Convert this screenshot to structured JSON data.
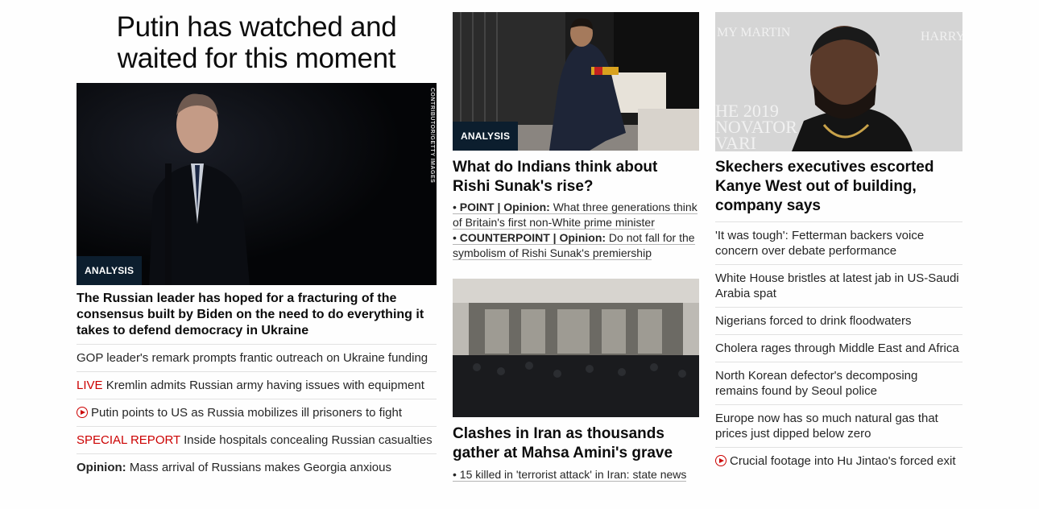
{
  "left": {
    "title": "Putin has watched and waited for this moment",
    "image_badge": "ANALYSIS",
    "image_credit": "CONTRIBUTOR/GETTY IMAGES",
    "headline": "The Russian leader has hoped for a fracturing of the consensus built by Biden on the need to do everything it takes to defend democracy in Ukraine",
    "items": [
      {
        "text": "GOP leader's remark prompts frantic outreach on Ukraine funding"
      },
      {
        "prefix": "LIVE",
        "text": "Kremlin admits Russian army having issues with equipment"
      },
      {
        "icon": "play-icon",
        "text": "Putin points to US as Russia mobilizes ill prisoners to fight"
      },
      {
        "prefix": "SPECIAL REPORT",
        "text": "Inside hospitals concealing Russian casualties"
      },
      {
        "prefix": "Opinion:",
        "text": "Mass arrival of Russians makes Georgia anxious"
      }
    ]
  },
  "middle": {
    "story1": {
      "image_badge": "ANALYSIS",
      "headline": "What do Indians think about Rishi Sunak's rise?",
      "bullet1_label": "POINT | Opinion:",
      "bullet1_text": "What three generations think of Britain's first non-White prime minister",
      "bullet2_label": "COUNTERPOINT | Opinion:",
      "bullet2_text": "Do not fall for the symbolism of Rishi Sunak's premiership"
    },
    "story2": {
      "headline": "Clashes in Iran as thousands gather at Mahsa Amini's grave",
      "bullet_text": "15 killed in 'terrorist attack' in Iran: state news"
    }
  },
  "right": {
    "image_backdrop": {
      "t1": "MY MARTIN",
      "t2": "HARRY",
      "t3": "HE 2019",
      "t4": "NOVATOR",
      "t5": "VARI"
    },
    "headline": "Skechers executives escorted Kanye West out of building, company says",
    "items": [
      {
        "text": "'It was tough': Fetterman backers voice concern over debate performance"
      },
      {
        "text": "White House bristles at latest jab in US-Saudi Arabia spat"
      },
      {
        "text": "Nigerians forced to drink floodwaters"
      },
      {
        "text": "Cholera rages through Middle East and Africa"
      },
      {
        "text": "North Korean defector's decomposing remains found by Seoul police"
      },
      {
        "text": "Europe now has so much natural gas that prices just dipped below zero"
      },
      {
        "icon": "play-icon",
        "text": "Crucial footage into Hu Jintao's forced exit"
      }
    ]
  },
  "colors": {
    "live_red": "#cc0000",
    "badge_bg": "#0c1e2e",
    "divider": "#e1e1e1"
  }
}
